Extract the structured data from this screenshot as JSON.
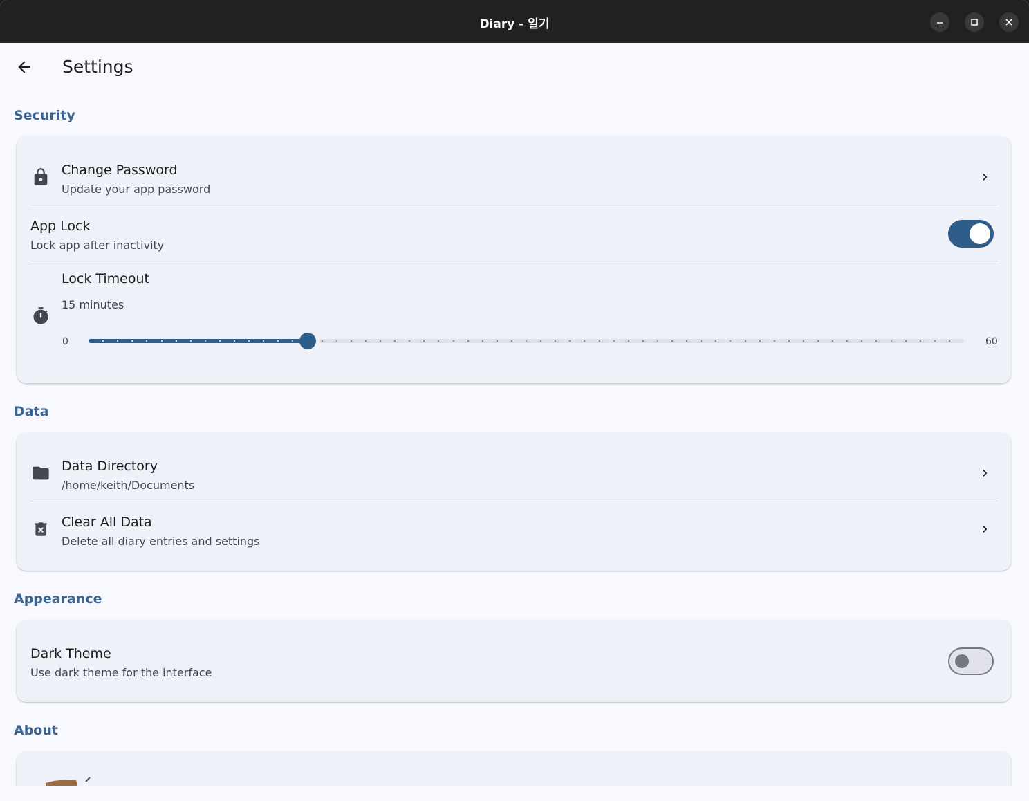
{
  "window": {
    "title": "Diary - 일기",
    "controls": [
      "minimize-icon",
      "maximize-icon",
      "close-icon"
    ]
  },
  "header": {
    "title": "Settings",
    "back_icon": "arrow-back-icon"
  },
  "sections": {
    "security": {
      "title": "Security",
      "change_password": {
        "title": "Change Password",
        "subtitle": "Update your app password",
        "icon": "lock-icon"
      },
      "app_lock": {
        "title": "App Lock",
        "subtitle": "Lock app after inactivity",
        "enabled": true
      },
      "lock_timeout": {
        "title": "Lock Timeout",
        "value_text": "15 minutes",
        "icon": "timer-icon",
        "min": "0",
        "max": "60",
        "value": 15,
        "min_num": 0,
        "max_num": 60
      }
    },
    "data": {
      "title": "Data",
      "data_directory": {
        "title": "Data Directory",
        "subtitle": "/home/keith/Documents",
        "icon": "folder-icon"
      },
      "clear_all": {
        "title": "Clear All Data",
        "subtitle": "Delete all diary entries and settings",
        "icon": "delete-icon"
      }
    },
    "appearance": {
      "title": "Appearance",
      "dark_theme": {
        "title": "Dark Theme",
        "subtitle": "Use dark theme for the interface",
        "enabled": false
      }
    },
    "about": {
      "title": "About",
      "icon": "diary-app-icon"
    }
  },
  "colors": {
    "accent": "#2f5d8a",
    "section_title": "#3a6591",
    "card_bg": "#eff1f8",
    "page_bg": "#f8f9ff",
    "titlebar_bg": "#212121"
  }
}
